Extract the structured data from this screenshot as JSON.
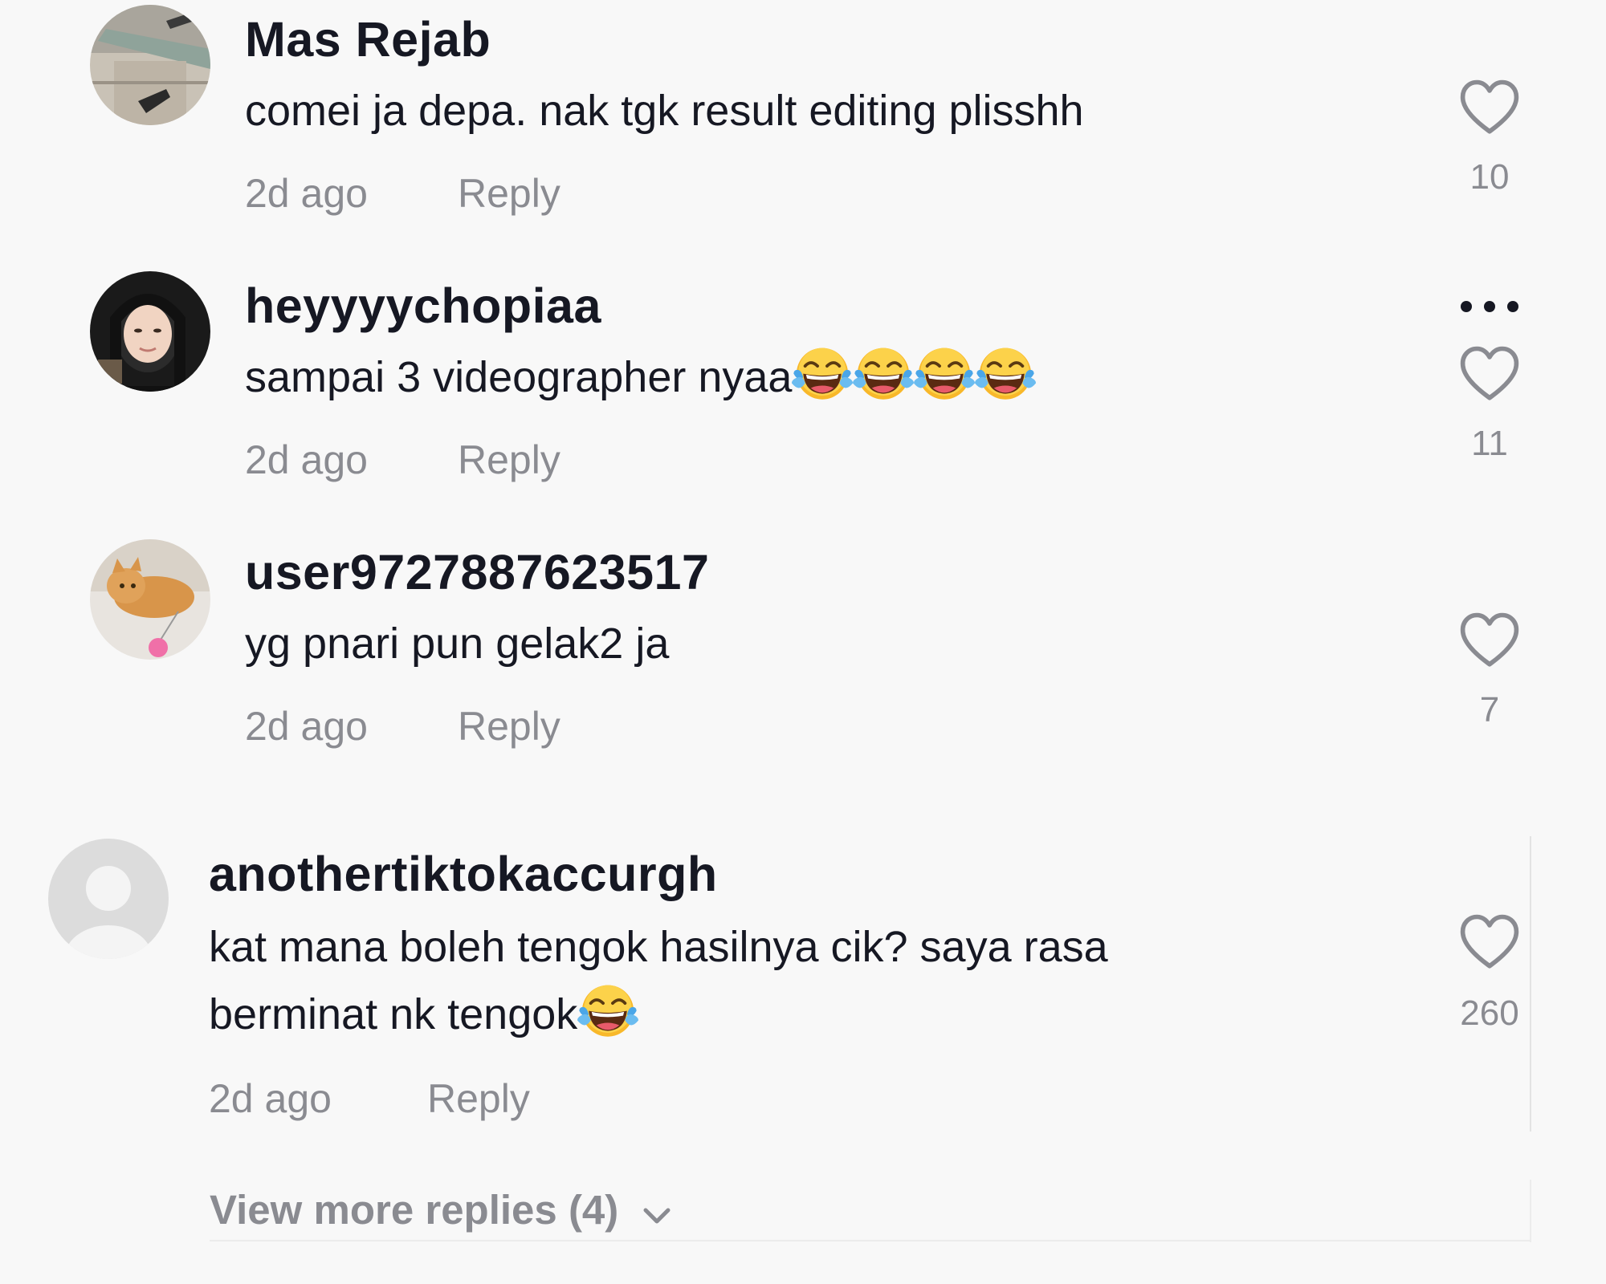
{
  "comments": [
    {
      "username": "Mas Rejab",
      "text": "comei ja depa. nak tgk result editing plisshh",
      "emoji_count": 0,
      "time": "2d ago",
      "reply_label": "Reply",
      "likes": "10",
      "avatar": "photo"
    },
    {
      "username": "heyyyychopiaa",
      "text": "sampai 3 videographer nyaa",
      "emoji_count": 4,
      "time": "2d ago",
      "reply_label": "Reply",
      "likes": "11",
      "avatar": "photo",
      "more_icon": "more-dots-icon"
    },
    {
      "username": "user9727887623517",
      "text": "yg pnari pun gelak2 ja",
      "emoji_count": 0,
      "time": "2d ago",
      "reply_label": "Reply",
      "likes": "7",
      "avatar": "photo"
    },
    {
      "username": "anothertiktokaccurgh",
      "text_line1": "kat mana boleh tengok hasilnya cik? saya rasa",
      "text_line2": "berminat nk tengok",
      "emoji_count": 1,
      "time": "2d ago",
      "reply_label": "Reply",
      "likes": "260",
      "avatar": "default-avatar-icon"
    }
  ],
  "view_more_replies": "View more replies (4)",
  "emoji": "face-with-tears-of-joy-icon",
  "colors": {
    "background": "#f8f8f8",
    "text_primary": "#161823",
    "text_secondary": "#8a8b91"
  }
}
